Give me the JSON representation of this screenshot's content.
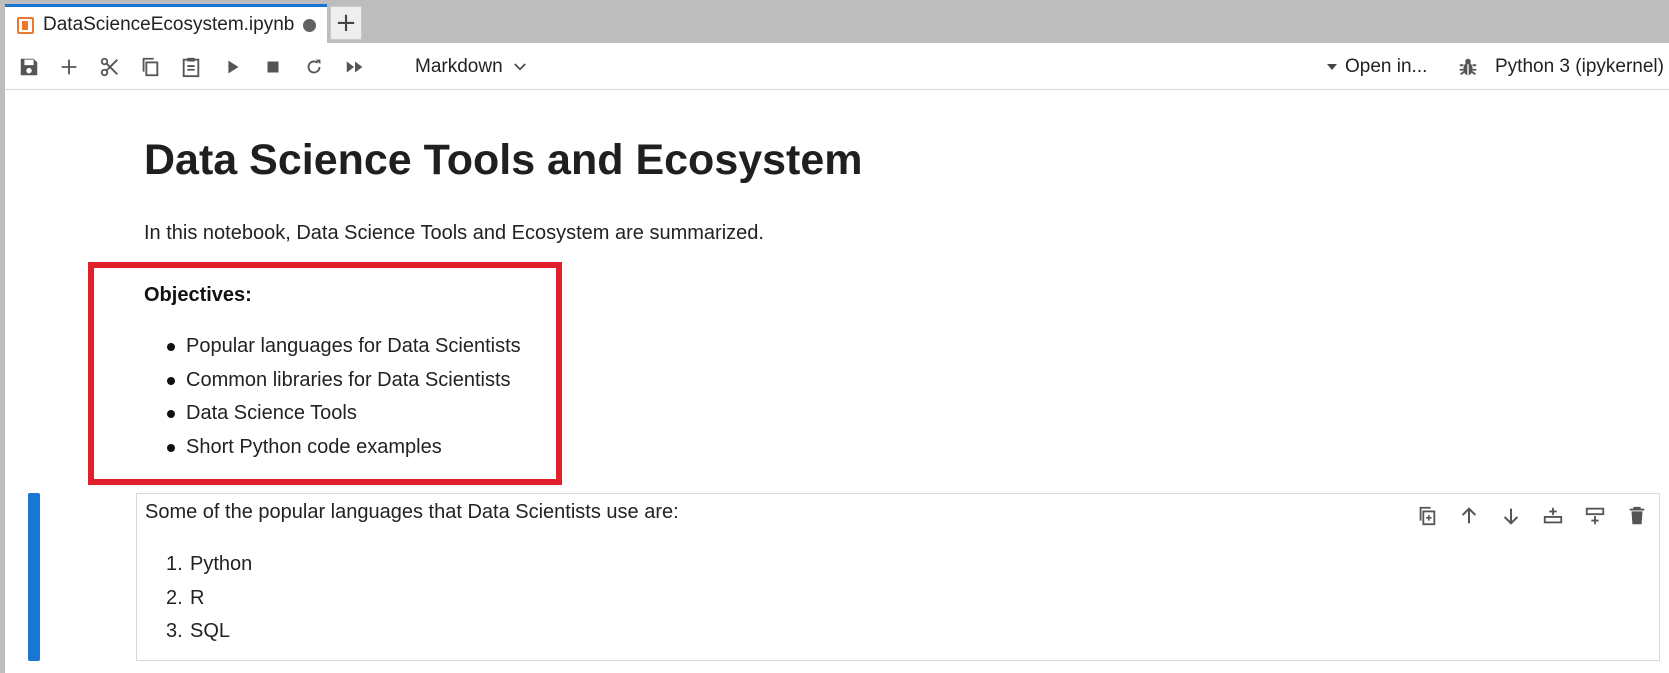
{
  "tab": {
    "title": "DataScienceEcosystem.ipynb",
    "new_tab_symbol": "+"
  },
  "toolbar": {
    "cell_type": "Markdown",
    "open_in": "Open in...",
    "kernel": "Python 3 (ipykernel)",
    "icons": [
      "save-icon",
      "add-cell-icon",
      "cut-icon",
      "copy-icon",
      "paste-icon",
      "run-icon",
      "stop-icon",
      "restart-icon",
      "run-all-icon"
    ]
  },
  "notebook": {
    "heading": "Data Science Tools and Ecosystem",
    "intro": "In this notebook, Data Science Tools and Ecosystem are summarized.",
    "objectives_title": "Objectives:",
    "objectives": [
      "Popular languages for Data Scientists",
      "Common libraries for Data Scientists",
      "Data Science Tools",
      "Short Python code examples"
    ],
    "highlight_color": "#e0202a",
    "active_cell": {
      "text": "Some of the popular languages that Data Scientists use are:",
      "languages": [
        {
          "num": "1.",
          "name": "Python"
        },
        {
          "num": "2.",
          "name": "R"
        },
        {
          "num": "3.",
          "name": "SQL"
        }
      ],
      "tools": [
        "duplicate-cell-icon",
        "move-up-icon",
        "move-down-icon",
        "insert-above-icon",
        "insert-below-icon",
        "delete-cell-icon"
      ]
    }
  },
  "colors": {
    "accent": "#1976d2",
    "tab_bar": "#bdbdbd",
    "notebook_icon": "#e8792d"
  }
}
